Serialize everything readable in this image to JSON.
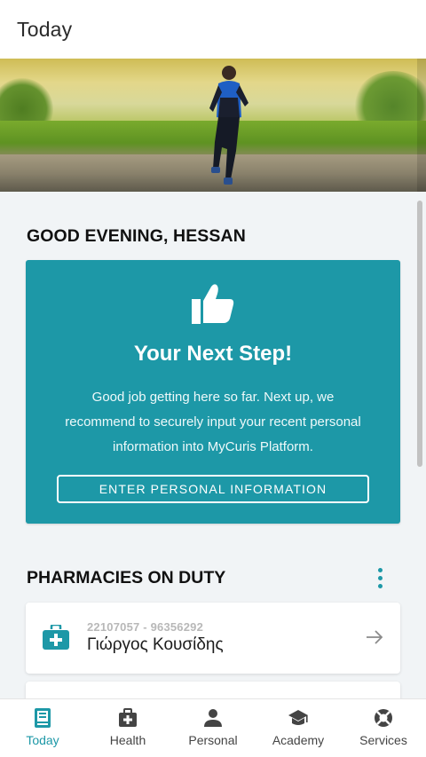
{
  "app_bar": {
    "title": "Today"
  },
  "hero": {
    "image": "runner-on-road"
  },
  "greeting": "GOOD EVENING, HESSAN",
  "next_step": {
    "icon": "thumbs-up-icon",
    "title": "Your Next Step!",
    "text": "Good job getting here so far. Next up, we recommend to securely input your recent personal information into MyCuris Platform.",
    "button_label": "ENTER PERSONAL INFORMATION"
  },
  "pharmacies": {
    "title": "PHARMACIES ON DUTY",
    "items": [
      {
        "phone": "22107057 - 96356292",
        "name": "Γιώργος Κουσίδης"
      }
    ]
  },
  "bottom_nav": {
    "items": [
      {
        "label": "Today",
        "icon": "today-icon",
        "active": true
      },
      {
        "label": "Health",
        "icon": "medical-bag-icon",
        "active": false
      },
      {
        "label": "Personal",
        "icon": "person-icon",
        "active": false
      },
      {
        "label": "Academy",
        "icon": "graduation-cap-icon",
        "active": false
      },
      {
        "label": "Services",
        "icon": "lifebuoy-icon",
        "active": false
      }
    ]
  },
  "colors": {
    "accent": "#1d98a7",
    "background": "#f1f4f6",
    "card": "#ffffff"
  }
}
